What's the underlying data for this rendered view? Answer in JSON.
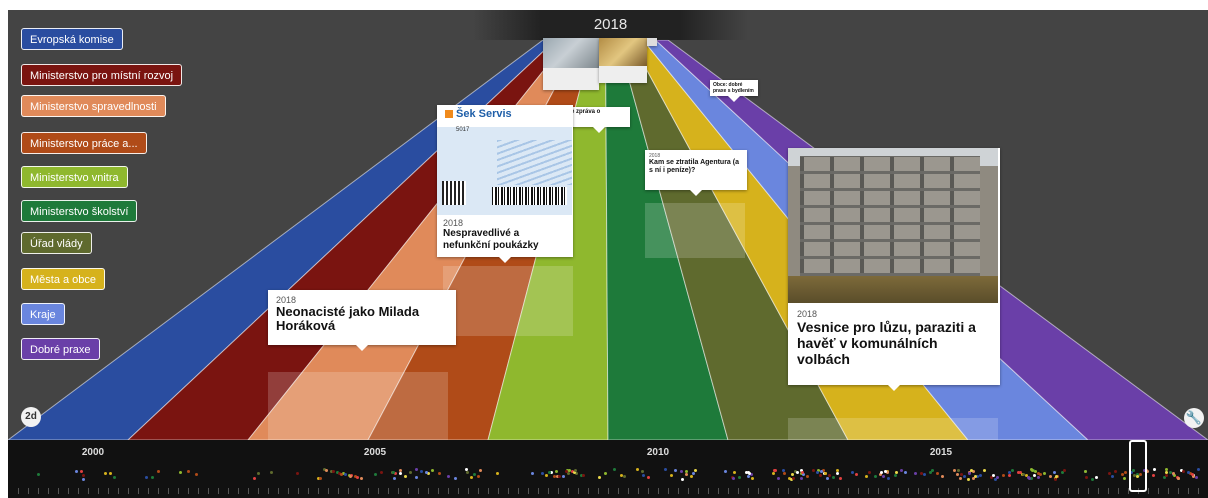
{
  "timeline": {
    "current_year": "2018",
    "zoom_button": "2d",
    "settings_icon": "wrench-icon"
  },
  "categories": [
    {
      "label": "Evropská komise",
      "color": "#2a4da0"
    },
    {
      "label": "Ministerstvo pro místní rozvoj",
      "color": "#7a1410"
    },
    {
      "label": "Ministerstvo spravedlnosti",
      "color": "#e08a5a"
    },
    {
      "label": "Ministerstvo práce a...",
      "color": "#b04b18"
    },
    {
      "label": "Ministerstvo vnitra",
      "color": "#8fb82e"
    },
    {
      "label": "Ministerstvo školství",
      "color": "#1e7a3a"
    },
    {
      "label": "Úřad vlády",
      "color": "#5f6a2e"
    },
    {
      "label": "Města a obce",
      "color": "#d6b21c"
    },
    {
      "label": "Kraje",
      "color": "#6a86de"
    },
    {
      "label": "Dobré praxe",
      "color": "#6a3fa8"
    }
  ],
  "events": {
    "neonaciste": {
      "year": "2018",
      "title": "Neonacisté jako Milada Horáková"
    },
    "poukazky": {
      "year": "2018",
      "title": "Nespravedlivé a nefunkční poukázky",
      "image_text": "Šek Servis",
      "image_sub": "5017"
    },
    "vesnice": {
      "year": "2018",
      "title": "Vesnice pro lůzu, paraziti a havěť v komunálních volbách"
    },
    "agentura": {
      "year": "2018",
      "title": "Kam se ztratila Agentura (a s ní i peníze)?"
    },
    "small1": {
      "title": "e zpráva o"
    },
    "small2": {
      "title": "Obce: dobré praxe s bydlením"
    }
  },
  "axis": {
    "years": [
      "2000",
      "2005",
      "2010",
      "2015"
    ]
  }
}
